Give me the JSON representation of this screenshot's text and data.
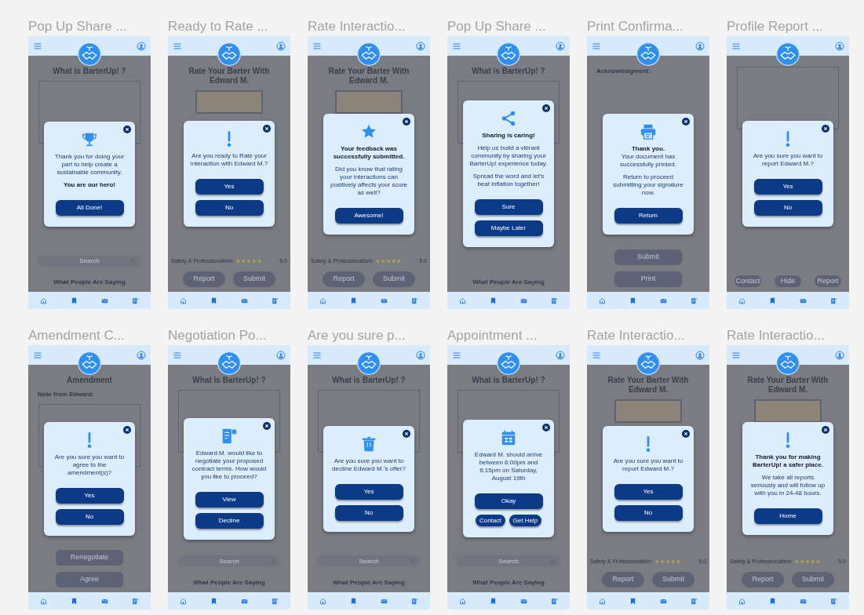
{
  "frames": [
    {
      "title": "Pop Up Share ...",
      "background": {
        "kind": "about",
        "heading": "What is BarterUp! ?",
        "search_placeholder": "Search",
        "footer_heading": "What People Are Saying"
      },
      "modal": {
        "kind": "thanks",
        "paragraphs": [
          {
            "text": "Thank you for doing your part to help create a sustainable community.",
            "bold": false
          },
          {
            "text": "You are our hero!",
            "bold": true
          }
        ],
        "buttons": [
          {
            "label": "All Done!",
            "kind": "wide"
          }
        ]
      }
    },
    {
      "title": "Ready to Rate ...",
      "background": {
        "kind": "rate",
        "heading": "Rate Your Barter With Edward M.",
        "rating": {
          "label": "Safety & Professionalism:",
          "value": "5.0",
          "stars": 5
        },
        "buttons": [
          "Report",
          "Submit"
        ]
      },
      "modal": {
        "kind": "confirm",
        "paragraphs": [
          {
            "text": "Are you ready to Rate your interaction with Edward M.?",
            "bold": false
          }
        ],
        "buttons": [
          {
            "label": "Yes",
            "kind": "wide"
          },
          {
            "label": "No",
            "kind": "wide"
          }
        ]
      }
    },
    {
      "title": "Rate Interactio...",
      "background": {
        "kind": "rate",
        "heading": "Rate Your Barter With Edward M.",
        "rating": {
          "label": "Safety & Professionalism:",
          "value": "5.0",
          "stars": 5
        },
        "buttons": [
          "Report",
          "Submit"
        ]
      },
      "modal": {
        "kind": "feedback",
        "paragraphs": [
          {
            "text": "Your feedback was successfully submitted.",
            "bold": true
          },
          {
            "text": "Did you know that rating your interactions can positively affects your score as well?",
            "bold": false
          }
        ],
        "buttons": [
          {
            "label": "Awesome!",
            "kind": "wide"
          }
        ]
      }
    },
    {
      "title": "Pop Up Share ...",
      "background": {
        "kind": "about",
        "heading": "What is BarterUp! ?",
        "footer_heading": "What People Are Saying"
      },
      "modal": {
        "kind": "share",
        "paragraphs": [
          {
            "text": "Sharing is caring!",
            "bold": true
          },
          {
            "text": "Help us build a vibrant community by sharing your BarterUp! experience today.",
            "bold": false
          },
          {
            "text": "Spread the word and let's beat inflation together!",
            "bold": false
          }
        ],
        "buttons": [
          {
            "label": "Sure",
            "kind": "wide"
          },
          {
            "label": "Maybe Later",
            "kind": "wide"
          }
        ]
      }
    },
    {
      "title": "Print Confirma...",
      "background": {
        "kind": "print",
        "label": "Acknowledgment:",
        "buttons": [
          "Submit",
          "Print"
        ]
      },
      "modal": {
        "kind": "print",
        "paragraphs": [
          {
            "text": "Thank you.",
            "bold": true
          },
          {
            "text": "Your document has successfully printed.",
            "bold": false
          },
          {
            "text": "Return to proceed submitting your signature now.",
            "bold": false
          }
        ],
        "buttons": [
          {
            "label": "Return",
            "kind": "wide"
          }
        ]
      }
    },
    {
      "title": "Profile Report ...",
      "background": {
        "kind": "profile",
        "buttons": [
          "Contact",
          "Hide",
          "Report"
        ]
      },
      "modal": {
        "kind": "confirm",
        "paragraphs": [
          {
            "text": "Are you sure you want to report Edward M.?",
            "bold": false
          }
        ],
        "buttons": [
          {
            "label": "Yes",
            "kind": "wide"
          },
          {
            "label": "No",
            "kind": "wide"
          }
        ]
      }
    },
    {
      "title": "Amendment C...",
      "background": {
        "kind": "amendment",
        "heading": "Amendment",
        "label": "Note from Edward:",
        "buttons": [
          "Renegotiate",
          "Agree"
        ]
      },
      "modal": {
        "kind": "confirm",
        "paragraphs": [
          {
            "text": "Are you sure you want to agree to the amendment(s)?",
            "bold": false
          }
        ],
        "buttons": [
          {
            "label": "Yes",
            "kind": "wide"
          },
          {
            "label": "No",
            "kind": "wide"
          }
        ]
      }
    },
    {
      "title": "Negotiation Po...",
      "background": {
        "kind": "about",
        "heading": "What is BarterUp! ?",
        "search_placeholder": "Search",
        "footer_heading": "What People Are Saying"
      },
      "modal": {
        "kind": "negotiate",
        "paragraphs": [
          {
            "text": "Edward M. would like to negotiate your proposed contract terms. How would you like to proceed?",
            "bold": false
          }
        ],
        "buttons": [
          {
            "label": "View",
            "kind": "wide"
          },
          {
            "label": "Decline",
            "kind": "wide"
          }
        ]
      }
    },
    {
      "title": "Are you sure p...",
      "background": {
        "kind": "about",
        "heading": "What is BarterUp! ?",
        "search_placeholder": "Search",
        "footer_heading": "What People Are Saying"
      },
      "modal": {
        "kind": "decline",
        "paragraphs": [
          {
            "text": "Are you sure you want to decline Edward M.'s offer?",
            "bold": false
          }
        ],
        "buttons": [
          {
            "label": "Yes",
            "kind": "wide"
          },
          {
            "label": "No",
            "kind": "wide"
          }
        ]
      }
    },
    {
      "title": "Appointment ...",
      "background": {
        "kind": "about",
        "heading": "What is BarterUp! ?",
        "search_placeholder": "Search",
        "footer_heading": "What People Are Saying"
      },
      "modal": {
        "kind": "appointment",
        "paragraphs": [
          {
            "text": "Edward M. should arrive between 6:00pm and 6:15pm on Saturday, August 19th",
            "bold": false
          }
        ],
        "buttons": [
          {
            "label": "Okay",
            "kind": "wide"
          },
          {
            "label": "Contact",
            "kind": "small"
          },
          {
            "label": "Get Help",
            "kind": "small"
          }
        ]
      }
    },
    {
      "title": "Rate Interactio...",
      "background": {
        "kind": "rate",
        "heading": "Rate Your Barter With Edward M.",
        "rating": {
          "label": "Safety & Professionalism:",
          "value": "5.0",
          "stars": 5
        },
        "buttons": [
          "Report",
          "Submit"
        ]
      },
      "modal": {
        "kind": "confirm",
        "paragraphs": [
          {
            "text": "Are you sure you want to report Edward M.?",
            "bold": false
          }
        ],
        "buttons": [
          {
            "label": "Yes",
            "kind": "wide"
          },
          {
            "label": "No",
            "kind": "wide"
          }
        ]
      }
    },
    {
      "title": "Rate Interactio...",
      "background": {
        "kind": "rate",
        "heading": "Rate Your Barter With Edward M.",
        "rating": {
          "label": "Safety & Professionalism:",
          "value": "5.0",
          "stars": 5
        },
        "buttons": [
          "Report",
          "Submit"
        ]
      },
      "modal": {
        "kind": "safety",
        "paragraphs": [
          {
            "text": "Thank you for making BarterUp! a safer place.",
            "bold": true
          },
          {
            "text": "We take all reports seriously and will follow up with you in 24-48 hours.",
            "bold": false
          }
        ],
        "buttons": [
          {
            "label": "Home",
            "kind": "wide"
          }
        ]
      }
    }
  ]
}
